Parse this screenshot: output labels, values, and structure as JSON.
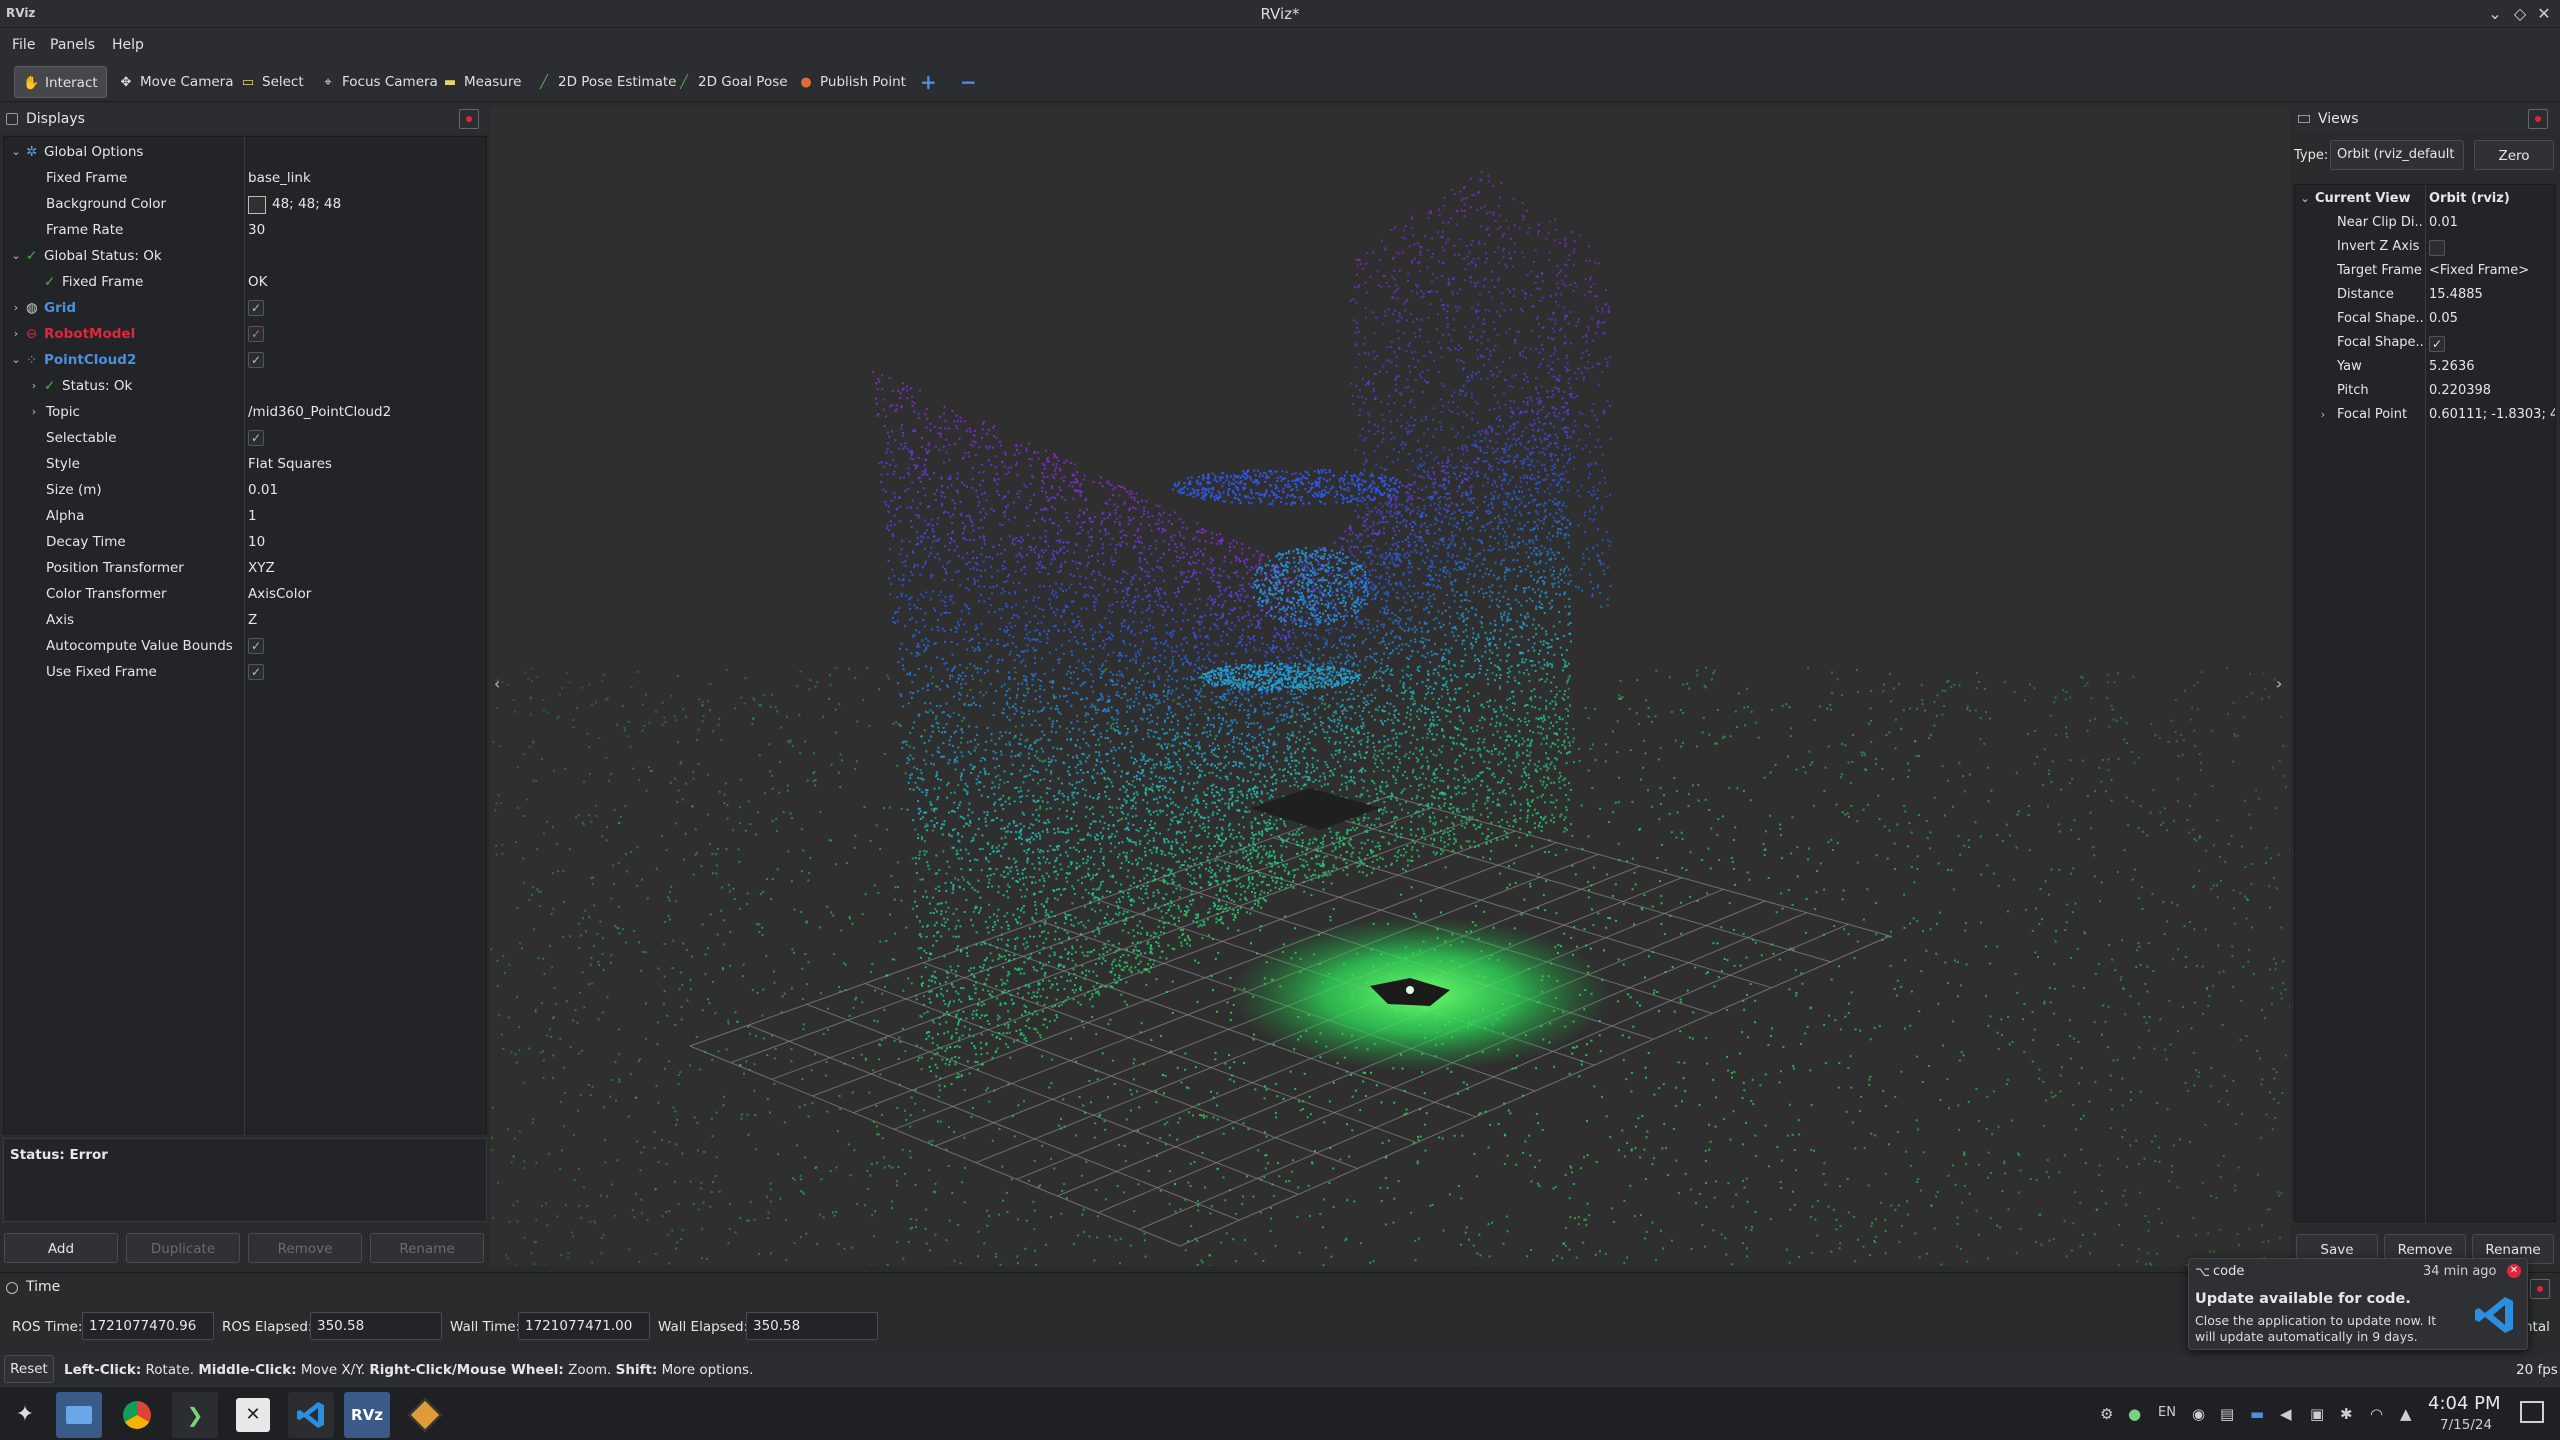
{
  "window": {
    "app_icon_label": "RViz",
    "title": "RViz*",
    "controls": [
      "⌄",
      "◇",
      "✕"
    ]
  },
  "menu": [
    "File",
    "Panels",
    "Help"
  ],
  "toolbar": {
    "tools": [
      {
        "label": "Interact",
        "icon": "hand-icon",
        "glyph": "✋",
        "active": true
      },
      {
        "label": "Move Camera",
        "icon": "move-icon",
        "glyph": "✥"
      },
      {
        "label": "Select",
        "icon": "select-icon",
        "glyph": "▭"
      },
      {
        "label": "Focus Camera",
        "icon": "crosshair-icon",
        "glyph": "⌖"
      },
      {
        "label": "Measure",
        "icon": "ruler-icon",
        "glyph": "▬"
      },
      {
        "label": "2D Pose Estimate",
        "icon": "pose-arrow-icon",
        "glyph": "╱"
      },
      {
        "label": "2D Goal Pose",
        "icon": "goal-arrow-icon",
        "glyph": "╱"
      },
      {
        "label": "Publish Point",
        "icon": "pin-icon",
        "glyph": "●"
      }
    ],
    "add_glyph": "+",
    "remove_glyph": "−"
  },
  "displays": {
    "title": "Displays",
    "rows": [
      {
        "level": 0,
        "expanded": true,
        "key": "Global Options",
        "icon": "gear-icon",
        "value": ""
      },
      {
        "level": 1,
        "key": "Fixed Frame",
        "value": "base_link"
      },
      {
        "level": 1,
        "key": "Background Color",
        "value": "48; 48; 48",
        "swatch": "#303030"
      },
      {
        "level": 1,
        "key": "Frame Rate",
        "value": "30"
      },
      {
        "level": 0,
        "expanded": true,
        "key": "Global Status: Ok",
        "icon": "check-icon",
        "value": ""
      },
      {
        "level": 1,
        "key": "Fixed Frame",
        "icon": "check-icon",
        "value": "OK"
      },
      {
        "level": 0,
        "collapsed": true,
        "key": "Grid",
        "icon": "grid-icon",
        "value": "",
        "checkbox": true,
        "color": "#4a8fe0"
      },
      {
        "level": 0,
        "collapsed": true,
        "key": "RobotModel",
        "icon": "error-icon",
        "value": "",
        "checkbox": true,
        "color": "#e0263b"
      },
      {
        "level": 0,
        "expanded": true,
        "key": "PointCloud2",
        "icon": "pointcloud-icon",
        "value": "",
        "checkbox": true,
        "color": "#4a8fe0"
      },
      {
        "level": 1,
        "collapsed": true,
        "key": "Status: Ok",
        "icon": "check-icon",
        "value": ""
      },
      {
        "level": 1,
        "collapsed": true,
        "key": "Topic",
        "value": "/mid360_PointCloud2"
      },
      {
        "level": 1,
        "key": "Selectable",
        "value": "",
        "checkbox": true
      },
      {
        "level": 1,
        "key": "Style",
        "value": "Flat Squares"
      },
      {
        "level": 1,
        "key": "Size (m)",
        "value": "0.01"
      },
      {
        "level": 1,
        "key": "Alpha",
        "value": "1"
      },
      {
        "level": 1,
        "key": "Decay Time",
        "value": "10"
      },
      {
        "level": 1,
        "key": "Position Transformer",
        "value": "XYZ"
      },
      {
        "level": 1,
        "key": "Color Transformer",
        "value": "AxisColor"
      },
      {
        "level": 1,
        "key": "Axis",
        "value": "Z"
      },
      {
        "level": 1,
        "key": "Autocompute Value Bounds",
        "value": "",
        "checkbox": true
      },
      {
        "level": 1,
        "key": "Use Fixed Frame",
        "value": "",
        "checkbox": true
      }
    ],
    "status_text": "Status: Error",
    "buttons": {
      "add": "Add",
      "duplicate": "Duplicate",
      "remove": "Remove",
      "rename": "Rename"
    }
  },
  "views": {
    "title": "Views",
    "type_label": "Type:",
    "type_value": "Orbit (rviz_default",
    "zero_label": "Zero",
    "header_key": "Current View",
    "header_value": "Orbit (rviz)",
    "rows": [
      {
        "key": "Near Clip Di...",
        "value": "0.01"
      },
      {
        "key": "Invert Z Axis",
        "value": "",
        "checkbox": true,
        "checked": false
      },
      {
        "key": "Target Frame",
        "value": "<Fixed Frame>"
      },
      {
        "key": "Distance",
        "value": "15.4885"
      },
      {
        "key": "Focal Shape...",
        "value": "0.05"
      },
      {
        "key": "Focal Shape...",
        "value": "",
        "checkbox": true,
        "checked": true
      },
      {
        "key": "Yaw",
        "value": "5.2636"
      },
      {
        "key": "Pitch",
        "value": "0.220398"
      },
      {
        "key": "Focal Point",
        "value": "0.60111; -1.8303; 4...",
        "collapsed": true
      }
    ],
    "buttons": {
      "save": "Save",
      "remove": "Remove",
      "rename": "Rename"
    }
  },
  "time": {
    "title": "Time",
    "ros_time_label": "ROS Time:",
    "ros_time": "1721077470.96",
    "ros_elapsed_label": "ROS Elapsed:",
    "ros_elapsed": "350.58",
    "wall_time_label": "Wall Time:",
    "wall_time": "1721077471.00",
    "wall_elapsed_label": "Wall Elapsed:",
    "wall_elapsed": "350.58",
    "right_fragment": "ntal"
  },
  "statusbar": {
    "reset": "Reset",
    "hint_parts": [
      {
        "text": "Left-Click:",
        "bold": true
      },
      {
        "text": " Rotate. ",
        "bold": false
      },
      {
        "text": "Middle-Click:",
        "bold": true
      },
      {
        "text": " Move X/Y. ",
        "bold": false
      },
      {
        "text": "Right-Click/Mouse Wheel:",
        "bold": true
      },
      {
        "text": " Zoom. ",
        "bold": false
      },
      {
        "text": "Shift:",
        "bold": true
      },
      {
        "text": " More options.",
        "bold": false
      }
    ],
    "fps": "20 fps"
  },
  "notification": {
    "app": "code",
    "age": "34 min ago",
    "title": "Update available for code.",
    "body": "Close the application to update now. It will update automatically in 9 days."
  },
  "taskbar": {
    "apps": [
      "launcher-icon",
      "files-icon",
      "chrome-icon",
      "terminal-icon",
      "x-icon",
      "vscode-icon",
      "rviz-icon",
      "package-icon"
    ],
    "rviz_label": "RVz",
    "lang": "EN",
    "time": "4:04 PM",
    "date": "7/15/24"
  },
  "colors": {
    "background": "#303030",
    "accent": "#4a8fe0",
    "error": "#e0263b",
    "ok": "#4caf50"
  }
}
